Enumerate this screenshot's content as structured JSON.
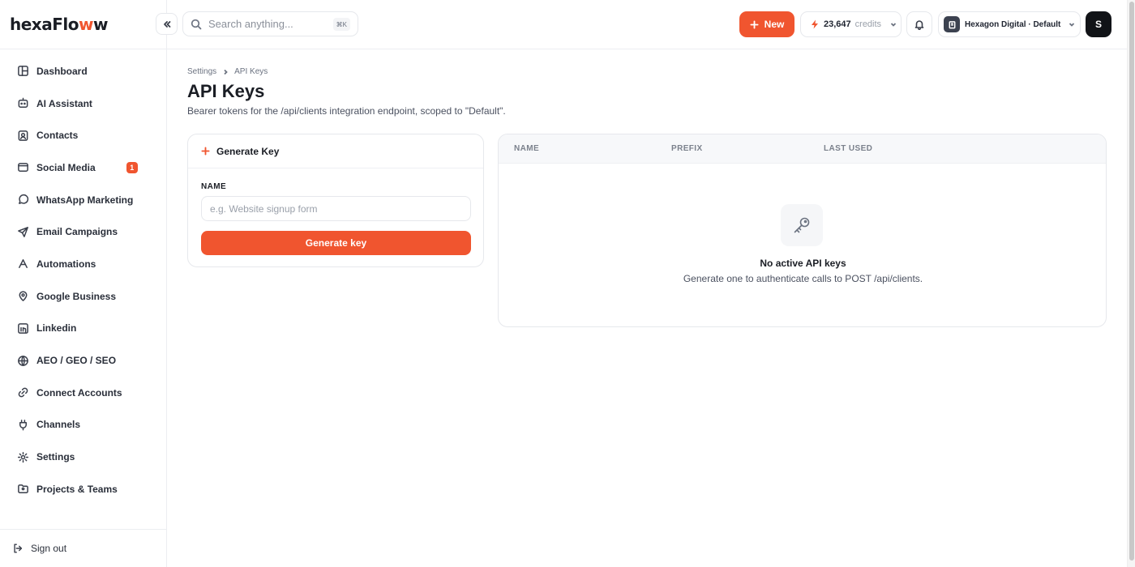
{
  "app": {
    "logo_main": "hexaFlo",
    "logo_accent": "w",
    "logo_tail": "w"
  },
  "sidebar": {
    "items": [
      {
        "label": "Dashboard",
        "icon": "dashboard-icon"
      },
      {
        "label": "AI Assistant",
        "icon": "bot-icon"
      },
      {
        "label": "Contacts",
        "icon": "contacts-icon"
      },
      {
        "label": "Social Media",
        "icon": "social-media-icon",
        "badge": "1"
      },
      {
        "label": "WhatsApp Marketing",
        "icon": "whatsapp-icon"
      },
      {
        "label": "Email Campaigns",
        "icon": "send-icon"
      },
      {
        "label": "Automations",
        "icon": "automations-icon"
      },
      {
        "label": "Google Business",
        "icon": "map-pin-icon"
      },
      {
        "label": "Linkedin",
        "icon": "linkedin-icon"
      },
      {
        "label": "AEO / GEO / SEO",
        "icon": "globe-icon"
      },
      {
        "label": "Connect Accounts",
        "icon": "link-icon"
      },
      {
        "label": "Channels",
        "icon": "plug-icon"
      },
      {
        "label": "Settings",
        "icon": "gear-icon"
      },
      {
        "label": "Projects & Teams",
        "icon": "folder-users-icon"
      }
    ],
    "signout_label": "Sign out"
  },
  "topbar": {
    "search_placeholder": "Search anything...",
    "search_shortcut": "⌘K",
    "new_label": "New",
    "credits_count": "23,647",
    "credits_label": "credits",
    "workspace_name": "Hexagon Digital · Default",
    "user_initial": "S"
  },
  "page": {
    "breadcrumb": [
      "Settings",
      "API Keys"
    ],
    "title": "API Keys",
    "subtitle": "Bearer tokens for the /api/clients integration endpoint, scoped to \"Default\"."
  },
  "generate_card": {
    "title": "Generate Key",
    "field_label": "NAME",
    "field_placeholder": "e.g. Website signup form",
    "field_value": "",
    "button_label": "Generate key"
  },
  "keys_table": {
    "columns": [
      "NAME",
      "PREFIX",
      "LAST USED"
    ],
    "rows": [],
    "empty_title": "No active API keys",
    "empty_subtitle": "Generate one to authenticate calls to POST /api/clients."
  },
  "colors": {
    "accent": "#f0552f",
    "text": "#1a1d24",
    "border": "#e6e8ec"
  }
}
